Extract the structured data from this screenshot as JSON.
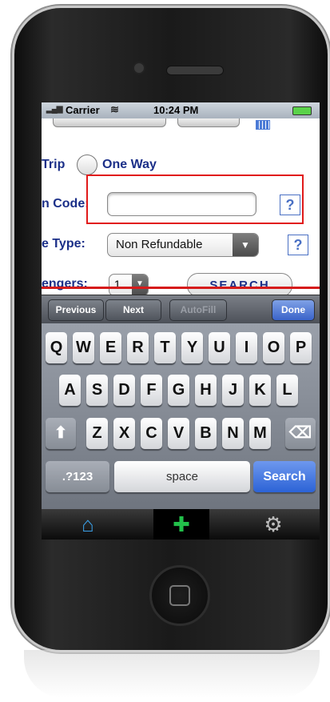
{
  "statusbar": {
    "signal": "▂▄▆",
    "carrier": "Carrier",
    "wifi": "≋",
    "time": "10:24 PM"
  },
  "form": {
    "trip_label": "Trip",
    "one_way_label": "One Way",
    "code_label": "n Code:",
    "code_value": "",
    "fare_type_label": "e Type:",
    "fare_type_value": "Non Refundable",
    "passengers_label": "engers:",
    "passengers_value": "1",
    "help": "?",
    "search_label": "SEARCH"
  },
  "toolbar": {
    "previous": "Previous",
    "next": "Next",
    "autofill": "AutoFill",
    "done": "Done"
  },
  "keyboard": {
    "row1": [
      "Q",
      "W",
      "E",
      "R",
      "T",
      "Y",
      "U",
      "I",
      "O",
      "P"
    ],
    "row2": [
      "A",
      "S",
      "D",
      "F",
      "G",
      "H",
      "J",
      "K",
      "L"
    ],
    "row3": [
      "Z",
      "X",
      "C",
      "V",
      "B",
      "N",
      "M"
    ],
    "shift": "⬆",
    "backspace": "⌫",
    "numbers": ".?123",
    "space": "space",
    "search": "Search"
  },
  "tabbar": {
    "home_icon": "⌂",
    "add_icon": "✚",
    "settings_icon": "⚙"
  },
  "colors": {
    "accent_blue": "#1b2f88",
    "highlight_red": "#e11a1a",
    "add_green": "#22c04a",
    "home_blue": "#3aa0e8"
  }
}
